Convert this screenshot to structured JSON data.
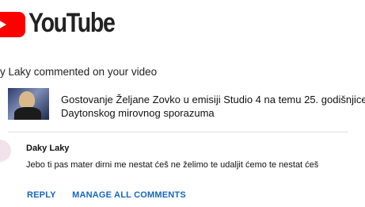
{
  "brand": {
    "name": "YouTube",
    "color": "#ff0000",
    "icon": "youtube-play-icon"
  },
  "notification": {
    "headline": "y Laky commented on your video"
  },
  "video": {
    "title": "Gostovanje Željane Zovko u emisiji Studio 4 na temu 25. godišnjice Daytonskog mirovnog sporazuma"
  },
  "comment": {
    "author": "Daky Laky",
    "text": "Jebo ti pas mater dirni me nestat ćeš ne želimo te udaljit ćemo te nestat ćeš"
  },
  "actions": {
    "reply_label": "REPLY",
    "manage_label": "MANAGE ALL COMMENTS",
    "link_color": "#1565c0"
  }
}
